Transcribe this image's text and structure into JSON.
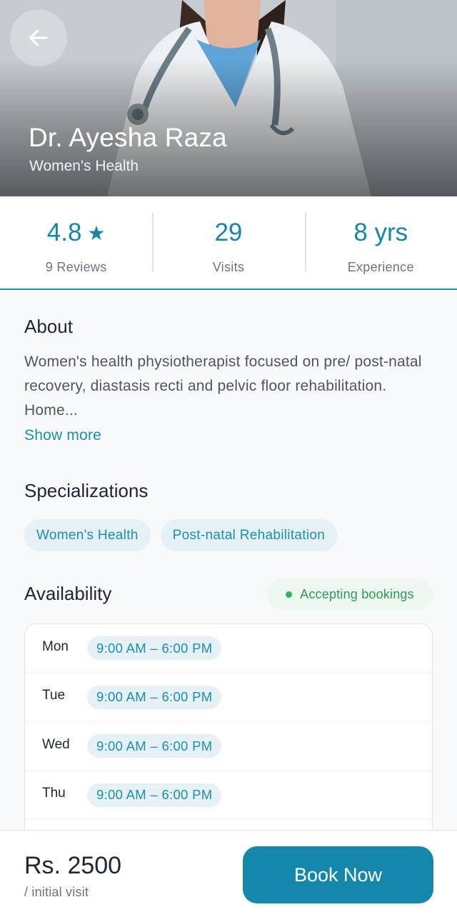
{
  "header": {
    "doctor_name": "Dr. Ayesha Raza",
    "specialty": "Women's Health",
    "back_icon": "arrow-left-icon"
  },
  "stats": [
    {
      "value": "4.8",
      "icon": "star-icon",
      "label": "9 Reviews"
    },
    {
      "value": "29",
      "label": "Visits"
    },
    {
      "value": "8 yrs",
      "label": "Experience"
    }
  ],
  "about": {
    "title": "About",
    "text": "Women's health physiotherapist focused on pre/ post-natal recovery, diastasis recti and pelvic floor rehabilitation. Home...",
    "show_more": "Show more"
  },
  "specializations": {
    "title": "Specializations",
    "items": [
      "Women's Health",
      "Post-natal Rehabilitation"
    ]
  },
  "availability": {
    "title": "Availability",
    "status": "Accepting bookings",
    "schedule": [
      {
        "day": "Mon",
        "hours": "9:00 AM – 6:00 PM"
      },
      {
        "day": "Tue",
        "hours": "9:00 AM – 6:00 PM"
      },
      {
        "day": "Wed",
        "hours": "9:00 AM – 6:00 PM"
      },
      {
        "day": "Thu",
        "hours": "9:00 AM – 6:00 PM"
      }
    ]
  },
  "footer": {
    "price": "Rs. 2500",
    "price_note": "/ initial visit",
    "book_label": "Book Now"
  },
  "colors": {
    "accent": "#1487ab",
    "status_green": "#2fb35e",
    "chip_bg": "#e6f1f5"
  }
}
